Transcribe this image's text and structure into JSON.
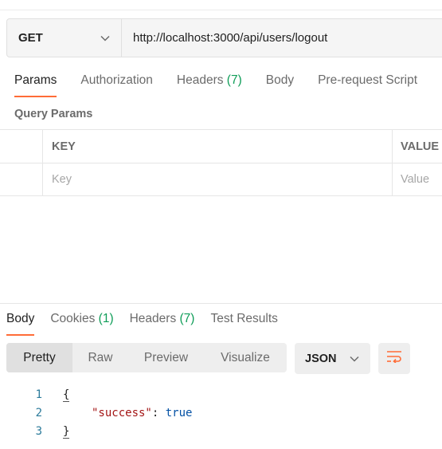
{
  "request": {
    "method": "GET",
    "url": "http://localhost:3000/api/users/logout"
  },
  "request_tabs": [
    {
      "label": "Params",
      "count": "",
      "active": true
    },
    {
      "label": "Authorization",
      "count": "",
      "active": false
    },
    {
      "label": "Headers ",
      "count": "(7)",
      "active": false
    },
    {
      "label": "Body",
      "count": "",
      "active": false
    },
    {
      "label": "Pre-request Script",
      "count": "",
      "active": false
    }
  ],
  "query_params": {
    "title": "Query Params",
    "columns": {
      "key": "KEY",
      "value": "VALUE"
    },
    "placeholder_row": {
      "key": "Key",
      "value": "Value"
    }
  },
  "response_tabs": [
    {
      "label": "Body",
      "count": "",
      "active": true
    },
    {
      "label": "Cookies ",
      "count": "(1)",
      "active": false
    },
    {
      "label": "Headers ",
      "count": "(7)",
      "active": false
    },
    {
      "label": "Test Results",
      "count": "",
      "active": false
    }
  ],
  "view_modes": [
    "Pretty",
    "Raw",
    "Preview",
    "Visualize"
  ],
  "format": "JSON",
  "code": {
    "line_numbers": [
      "1",
      "2",
      "3"
    ],
    "open_brace": "{",
    "key": "\"success\"",
    "colon": ": ",
    "value": "true",
    "close_brace": "}"
  },
  "colors": {
    "accent": "#ff6c37",
    "count": "#0f9d58",
    "json_key": "#a31515",
    "json_bool": "#0451a5"
  }
}
